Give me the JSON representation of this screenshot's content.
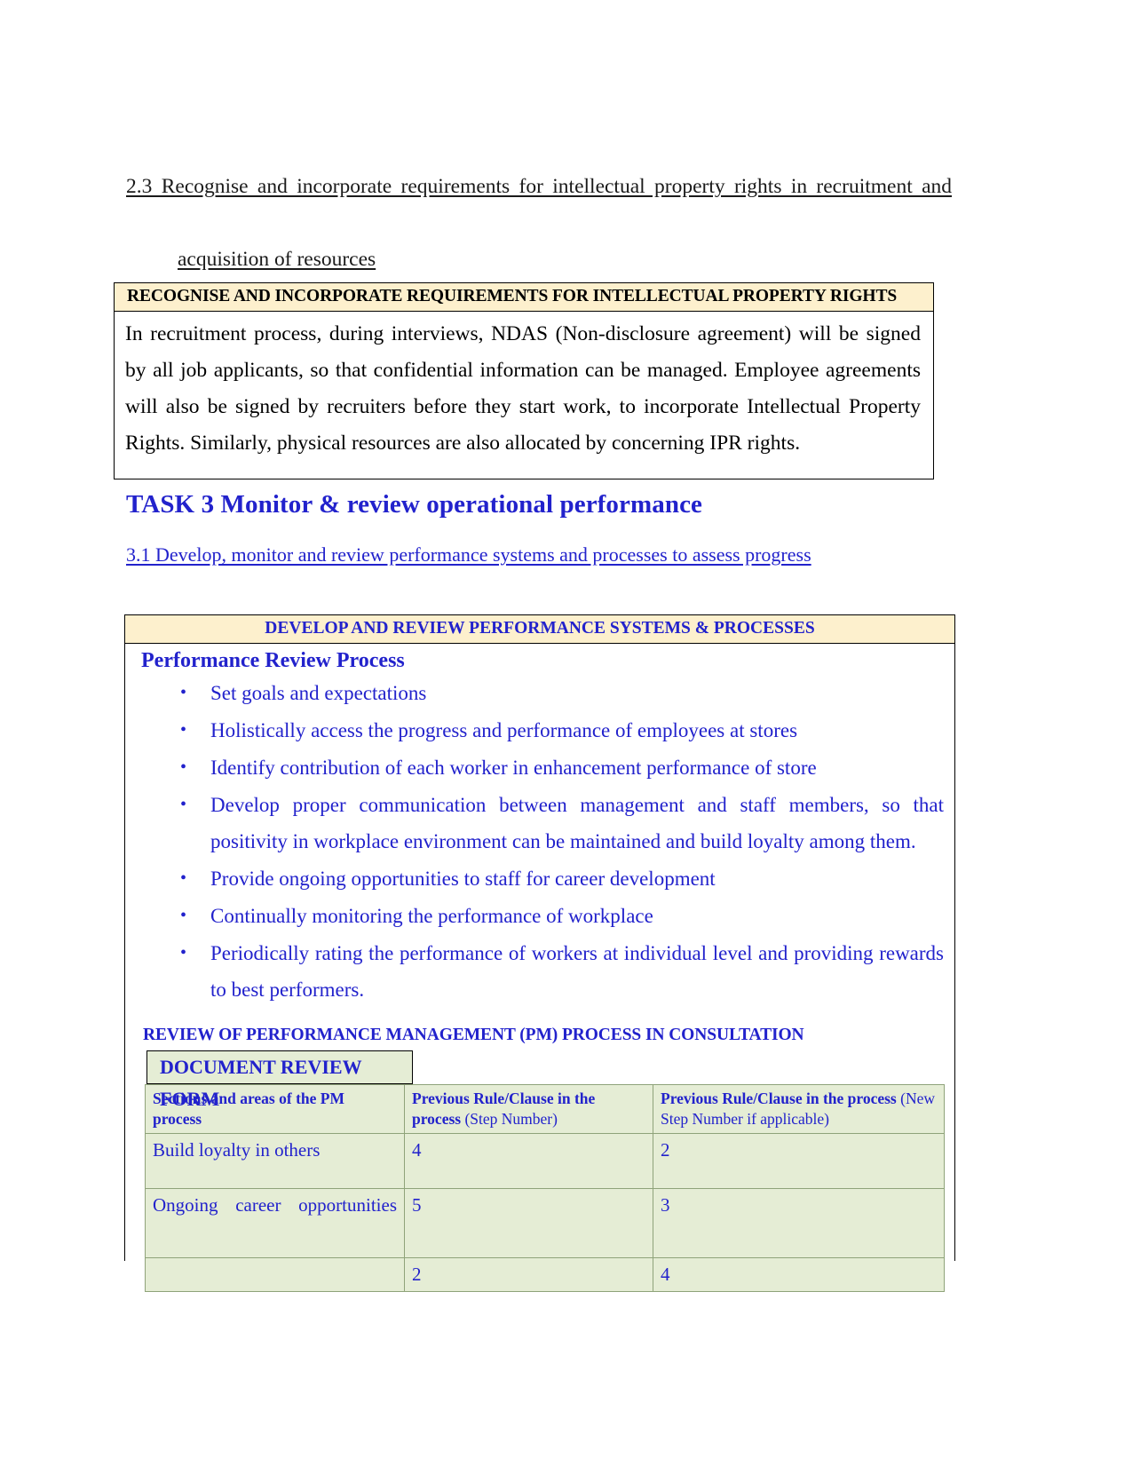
{
  "section": {
    "heading_line1": "2.3 Recognise and incorporate requirements for intellectual property rights in recruitment and",
    "heading_line2": "acquisition of resources"
  },
  "ipr_box": {
    "header": "RECOGNISE AND INCORPORATE REQUIREMENTS FOR INTELLECTUAL PROPERTY RIGHTS",
    "body": "In recruitment process, during interviews, NDAS (Non-disclosure agreement) will be signed by all job applicants, so that confidential information can be managed. Employee agreements will also be signed by recruiters before they start work, to incorporate Intellectual Property Rights. Similarly, physical resources are also allocated by concerning IPR rights."
  },
  "task": {
    "title": "TASK 3 Monitor & review operational performance",
    "subheading": "3.1 Develop, monitor and review performance systems and processes to assess progress"
  },
  "performance_box": {
    "header": "DEVELOP AND REVIEW PERFORMANCE SYSTEMS & PROCESSES",
    "subtitle": "Performance Review Process",
    "bullets": [
      "Set goals and expectations",
      "Holistically access the progress and performance of employees at stores",
      "Identify contribution of each worker in enhancement performance of store",
      "Develop proper communication between management and staff members, so that positivity in workplace environment can be maintained and build loyalty among them.",
      "Provide ongoing opportunities to staff for career development",
      "Continually monitoring the performance of workplace",
      "Periodically rating the performance of workers at individual level and providing rewards to best performers."
    ],
    "review_heading": "REVIEW OF PERFORMANCE MANAGEMENT (PM) PROCESS IN CONSULTATION",
    "form_tab": "DOCUMENT REVIEW FORM",
    "table": {
      "headers": [
        {
          "main": "Sections and areas of the PM process",
          "sub": ""
        },
        {
          "main": "Previous Rule/Clause in the process",
          "sub": " (Step Number)"
        },
        {
          "main": "Previous Rule/Clause in the process",
          "sub": "(New Step Number if applicable)"
        }
      ],
      "rows": [
        {
          "section": "Build loyalty in others",
          "previous": "4",
          "new": "2"
        },
        {
          "section": "Ongoing career opportunities",
          "previous": "5",
          "new": "3"
        },
        {
          "section": "",
          "previous": "2",
          "new": "4"
        }
      ]
    }
  },
  "colors": {
    "accent_blue": "#2222cc",
    "header_cream": "#fdf0cd",
    "table_green": "#e5edd5",
    "page_bg": "#ffffff"
  }
}
